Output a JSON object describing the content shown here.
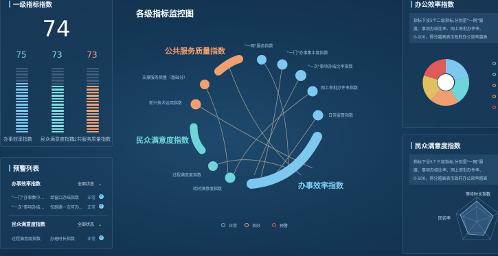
{
  "left_top": {
    "title": "一级指标指数",
    "big_value": "74",
    "bars": [
      {
        "value": "75",
        "label": "办事效率指数",
        "color": "#7ec8f0",
        "fill": 0.75
      },
      {
        "value": "73",
        "label": "民众满意度指数",
        "color": "#7ee0e0",
        "fill": 0.73
      },
      {
        "value": "73",
        "label": "公共服务质量指数",
        "color": "#f0a070",
        "fill": 0.73
      }
    ]
  },
  "warn": {
    "title": "预警列表",
    "groups": [
      {
        "name": "办事效率指数",
        "filter": "全部状态",
        "rows": [
          {
            "c1": "\"一门\"办事集中...",
            "c2": "单窗口办结指数",
            "status": "正常"
          },
          {
            "c1": "\"一次\"事项办结...",
            "c2": "仅跑路一次可办...",
            "status": "正常"
          }
        ]
      },
      {
        "name": "民众满意度指数",
        "filter": "全部状态",
        "rows": [
          {
            "c1": "过程满意度指数",
            "c2": "办理时长指数",
            "status": "正常"
          }
        ]
      }
    ]
  },
  "center": {
    "title": "各级指标监控图",
    "groups": {
      "public": "公共服务质量指数",
      "people": "民众满意度指数",
      "efficiency": "办事效率指数"
    },
    "nodes": {
      "n1": "\"一网\"服务指数",
      "n2": "\"一门\"办事集中度指数",
      "n3": "\"一次\"事项办结比率指数",
      "n4": "网上审批办件率指数",
      "n5": "日常监督指数",
      "n6": "支撑服务质量（基础分）",
      "n7": "新兴技术运用指数",
      "n8": "过程满意度指数",
      "n9": "耗时满意度指数"
    },
    "legend": [
      {
        "label": "正常",
        "color": "#6ab4ea"
      },
      {
        "label": "良好",
        "color": "#f0a070"
      },
      {
        "label": "预警",
        "color": "#e05a5a"
      }
    ]
  },
  "right_top": {
    "title": "办公效率指数",
    "desc": [
      "指标下设5个二级指标,分别是\"一网\"服",
      "度、事项办结比率、网上审批办件率、",
      "0-100，得分越高表示政府办公效率越高"
    ]
  },
  "right_bottom": {
    "title": "民众满意度指数",
    "desc": [
      "指标下设5个三级指标,分别是\"一网\"服",
      "度、事项办结比率、网上审批办件率、",
      "0-100，得分越高表示政府办公效率越高"
    ],
    "radar_labels": [
      "等待时长指数",
      "回访率"
    ]
  }
}
